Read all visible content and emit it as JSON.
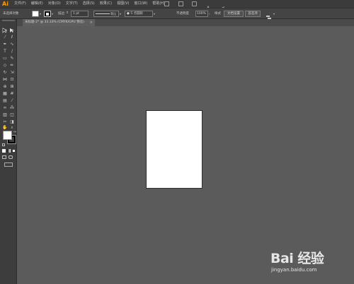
{
  "app": {
    "logo_text": "Ai",
    "logo_color": "#ff9a00"
  },
  "menubar": {
    "items": [
      "文件(F)",
      "编辑(E)",
      "对象(O)",
      "文字(T)",
      "选择(S)",
      "效果(C)",
      "视图(V)",
      "窗口(W)",
      "帮助(H)"
    ]
  },
  "controlbar": {
    "selection_status": "未选择对象",
    "stroke_label": "描边",
    "stroke_value": "1 pt",
    "stroke_style": "等比",
    "brush_value": "5 点圆形",
    "opacity_label": "不透明度",
    "opacity_value": "100%",
    "style_label": "样式",
    "document_setup_button": "文档设置",
    "preferences_button": "首选项"
  },
  "document_tab": {
    "title": "未标题-2* @ 33.33% (CMYK/GPU 预览)",
    "close_glyph": "×"
  },
  "colors": {
    "canvas": "#5b5b5b",
    "fill": "#ffffff",
    "stroke": "#000000",
    "accent": "#ff9a00"
  },
  "watermark": {
    "brand": "Bai 经验",
    "url": "jingyan.baidu.com"
  }
}
